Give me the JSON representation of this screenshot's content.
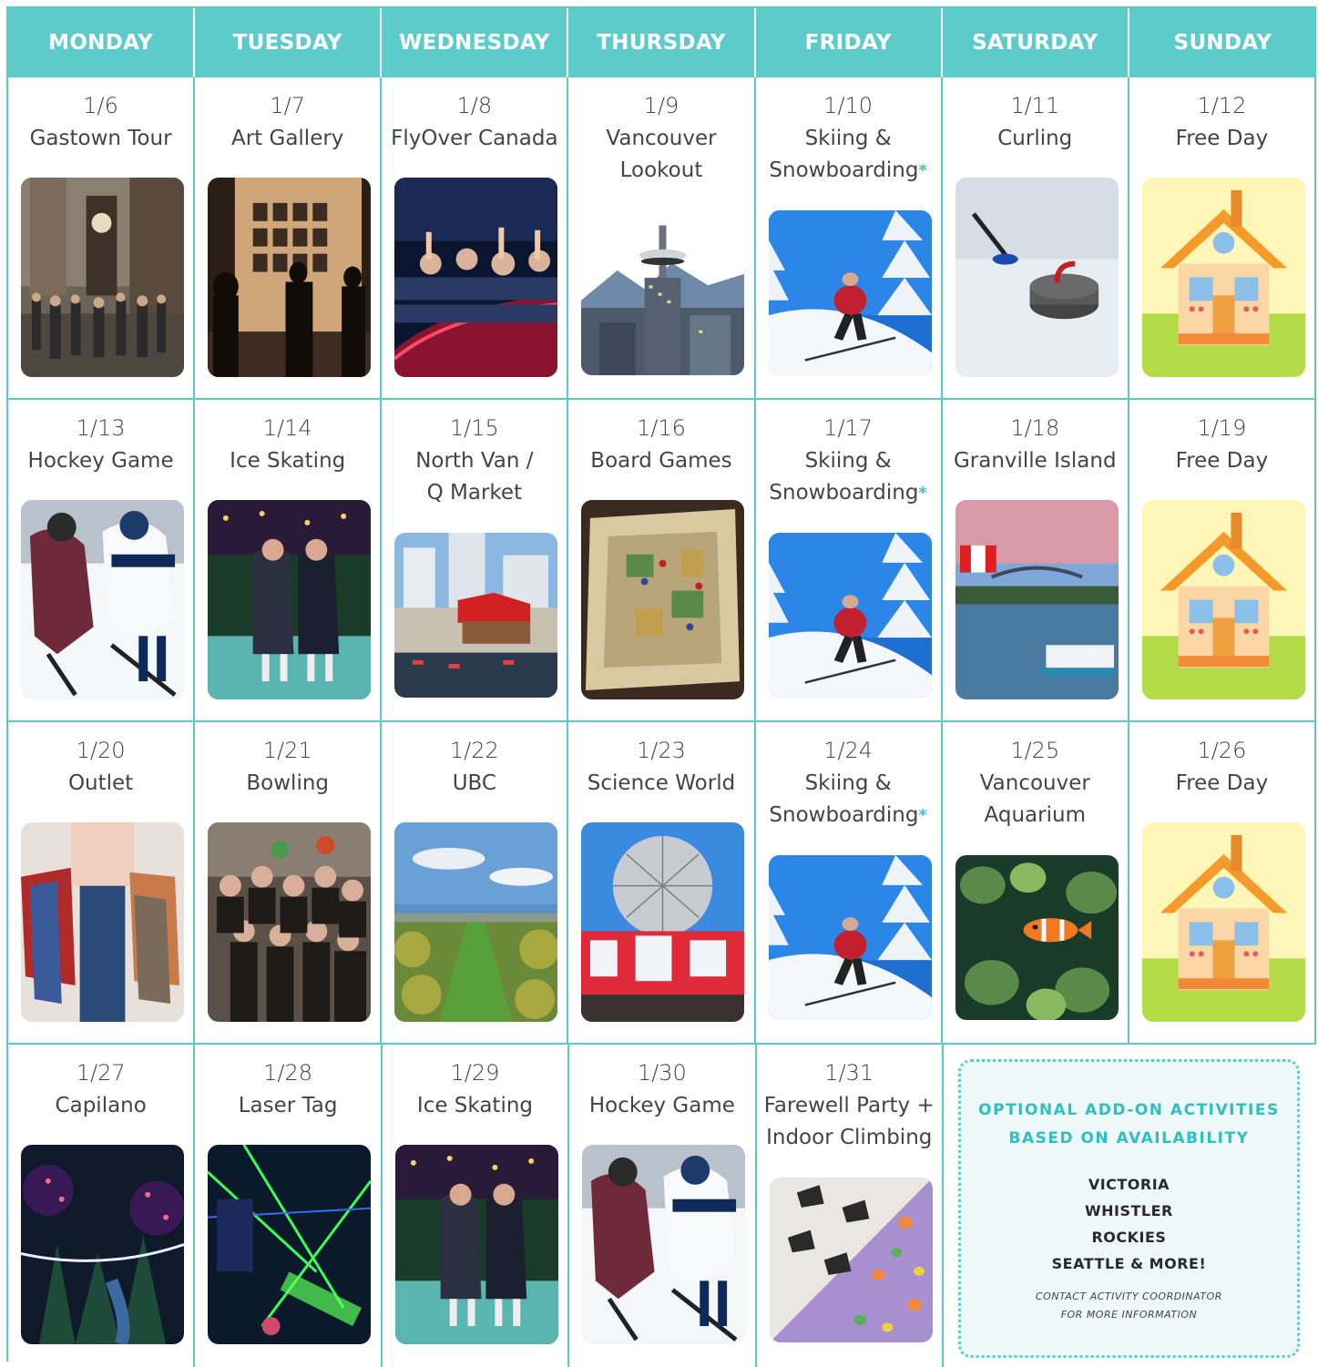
{
  "days": [
    "MONDAY",
    "TUESDAY",
    "WEDNESDAY",
    "THURSDAY",
    "FRIDAY",
    "SATURDAY",
    "SUNDAY"
  ],
  "colors": {
    "accent": "#5ecbcb",
    "accent_text": "#2fbfbf"
  },
  "weeks": [
    [
      {
        "date": "1/6",
        "activity": "Gastown Tour",
        "icon": "gastown-clock-photo"
      },
      {
        "date": "1/7",
        "activity": "Art Gallery",
        "icon": "art-gallery-photo"
      },
      {
        "date": "1/8",
        "activity": "FlyOver Canada",
        "icon": "flyover-canada-photo"
      },
      {
        "date": "1/9",
        "activity": "Vancouver\nLookout",
        "icon": "vancouver-lookout-photo"
      },
      {
        "date": "1/10",
        "activity": "Skiing &\nSnowboarding",
        "asterisk": "*",
        "icon": "skiing-photo"
      },
      {
        "date": "1/11",
        "activity": "Curling",
        "icon": "curling-photo"
      },
      {
        "date": "1/12",
        "activity": "Free Day",
        "icon": "house-illustration"
      }
    ],
    [
      {
        "date": "1/13",
        "activity": "Hockey Game",
        "icon": "hockey-photo"
      },
      {
        "date": "1/14",
        "activity": "Ice Skating",
        "icon": "ice-skating-photo"
      },
      {
        "date": "1/15",
        "activity": "North Van /\nQ Market",
        "icon": "north-van-photo"
      },
      {
        "date": "1/16",
        "activity": "Board Games",
        "icon": "board-games-photo"
      },
      {
        "date": "1/17",
        "activity": "Skiing &\nSnowboarding",
        "asterisk": "*",
        "icon": "skiing-photo"
      },
      {
        "date": "1/18",
        "activity": "Granville Island",
        "icon": "granville-island-photo"
      },
      {
        "date": "1/19",
        "activity": "Free Day",
        "icon": "house-illustration"
      }
    ],
    [
      {
        "date": "1/20",
        "activity": "Outlet",
        "icon": "shopping-photo"
      },
      {
        "date": "1/21",
        "activity": "Bowling",
        "icon": "bowling-photo"
      },
      {
        "date": "1/22",
        "activity": "UBC",
        "icon": "ubc-photo"
      },
      {
        "date": "1/23",
        "activity": "Science World",
        "icon": "science-world-photo"
      },
      {
        "date": "1/24",
        "activity": "Skiing &\nSnowboarding",
        "asterisk": "*",
        "icon": "skiing-photo"
      },
      {
        "date": "1/25",
        "activity": "Vancouver\nAquarium",
        "icon": "aquarium-photo"
      },
      {
        "date": "1/26",
        "activity": "Free Day",
        "icon": "house-illustration"
      }
    ],
    [
      {
        "date": "1/27",
        "activity": "Capilano",
        "icon": "capilano-photo"
      },
      {
        "date": "1/28",
        "activity": "Laser Tag",
        "icon": "laser-tag-photo"
      },
      {
        "date": "1/29",
        "activity": "Ice Skating",
        "icon": "ice-skating-photo"
      },
      {
        "date": "1/30",
        "activity": "Hockey Game",
        "icon": "hockey-photo"
      },
      {
        "date": "1/31",
        "activity": "Farewell Party +\nIndoor Climbing",
        "icon": "party-climbing-photo"
      }
    ]
  ],
  "addon": {
    "title_line1": "OPTIONAL ADD-ON ACTIVITIES",
    "title_line2": "BASED ON AVAILABILITY",
    "items": [
      "VICTORIA",
      "WHISTLER",
      "ROCKIES",
      "SEATTLE & MORE!"
    ],
    "note_line1": "CONTACT ACTIVITY COORDINATOR",
    "note_line2": "FOR MORE INFORMATION"
  }
}
